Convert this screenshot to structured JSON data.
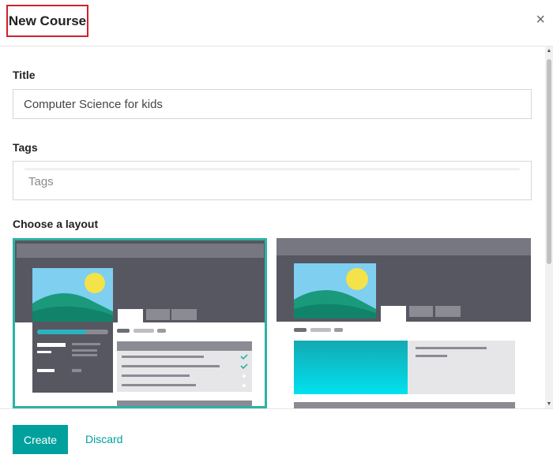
{
  "dialog": {
    "title": "New Course",
    "close_symbol": "×"
  },
  "form": {
    "title_label": "Title",
    "title_value": "Computer Science for kids",
    "tags_label": "Tags",
    "tags_placeholder": "Tags",
    "layout_label": "Choose a layout",
    "layouts": [
      {
        "selected": true
      },
      {
        "selected": false
      }
    ]
  },
  "footer": {
    "create_label": "Create",
    "discard_label": "Discard"
  },
  "colors": {
    "accent": "#00a09d",
    "selected_border": "#2bb3a7",
    "highlight_box": "#d0212c"
  }
}
